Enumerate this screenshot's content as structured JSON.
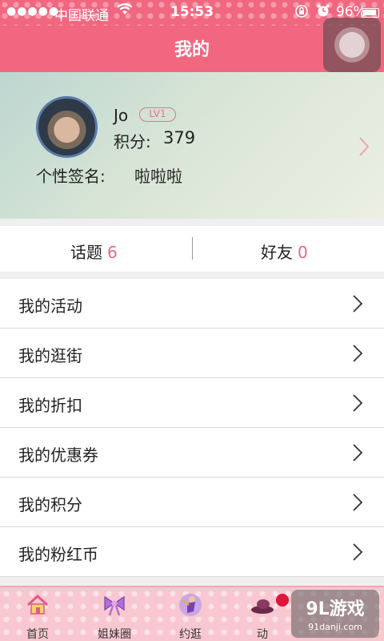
{
  "status_bar": {
    "signal": "●●●●●",
    "carrier": "中国联通",
    "time": "15:53",
    "battery": "96%"
  },
  "header": {
    "title": "我的"
  },
  "profile": {
    "username": "Jo",
    "level": "LV1",
    "points_label": "积分:",
    "points_value": "379",
    "signature_label": "个性签名:",
    "signature_value": "啦啦啦"
  },
  "stats": {
    "topics_label": "话题",
    "topics_count": "6",
    "friends_label": "好友",
    "friends_count": "0"
  },
  "menu": {
    "items": [
      {
        "label": "我的活动"
      },
      {
        "label": "我的逛街"
      },
      {
        "label": "我的折扣"
      },
      {
        "label": "我的优惠券"
      },
      {
        "label": "我的积分"
      },
      {
        "label": "我的粉红币"
      }
    ]
  },
  "tabbar": {
    "tabs": [
      {
        "label": "首页",
        "icon": "house-icon"
      },
      {
        "label": "姐妹圈",
        "icon": "bow-icon"
      },
      {
        "label": "约逛",
        "icon": "girl-icon"
      },
      {
        "label": "动",
        "icon": "hat-icon"
      }
    ]
  },
  "watermark": {
    "main": "9L游戏",
    "sub": "91danji.com"
  },
  "colors": {
    "accent": "#f0677f",
    "tabbar": "#f9c7cf"
  }
}
